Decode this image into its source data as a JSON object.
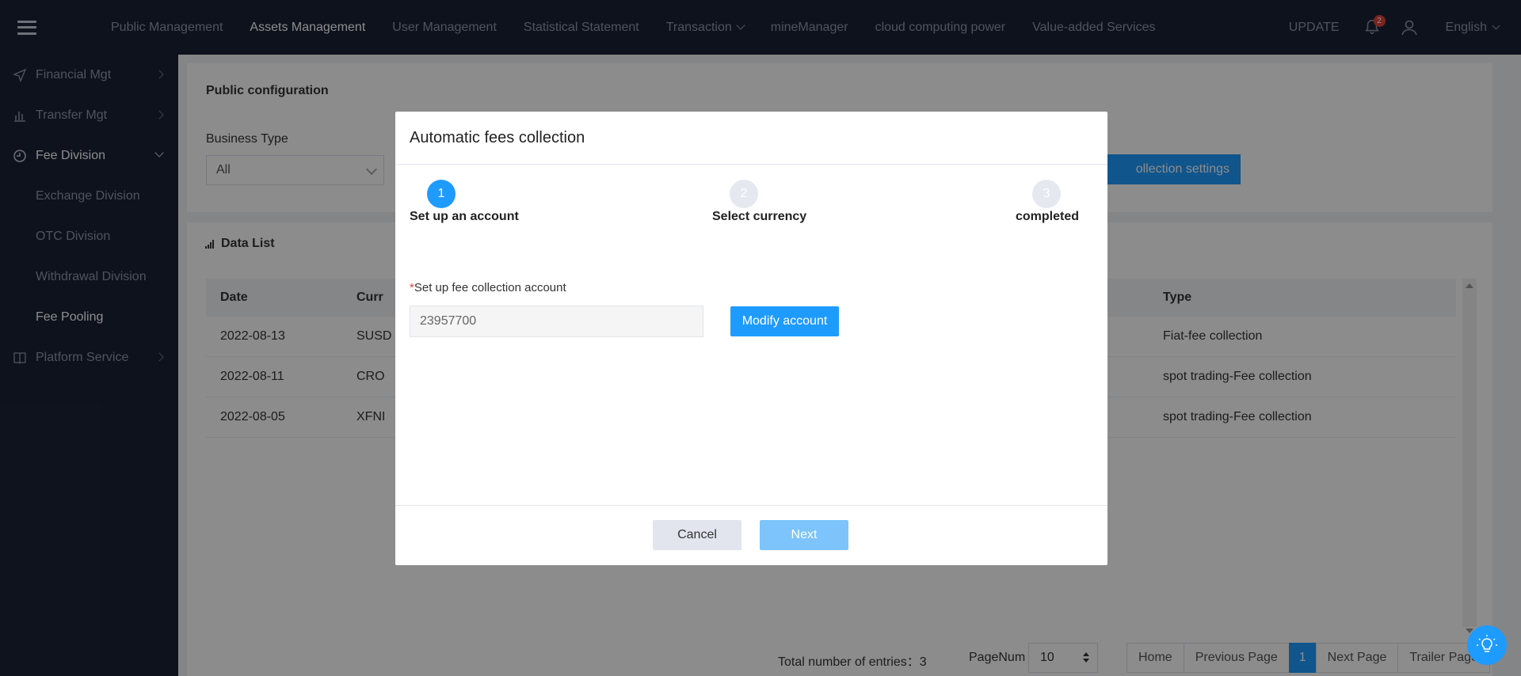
{
  "topbar": {
    "nav": [
      {
        "label": "Public Management",
        "active": false
      },
      {
        "label": "Assets Management",
        "active": true
      },
      {
        "label": "User Management",
        "active": false
      },
      {
        "label": "Statistical Statement",
        "active": false
      },
      {
        "label": "Transaction",
        "active": false
      },
      {
        "label": "mineManager",
        "active": false
      },
      {
        "label": "cloud computing power",
        "active": false
      },
      {
        "label": "Value-added Services",
        "active": false
      }
    ],
    "update_label": "UPDATE",
    "notification_count": "2",
    "language": "English"
  },
  "sidebar": {
    "items": [
      {
        "label": "Financial Mgt",
        "icon": "send-icon"
      },
      {
        "label": "Transfer Mgt",
        "icon": "bar-chart-icon"
      },
      {
        "label": "Fee Division",
        "icon": "clock-icon"
      },
      {
        "label": "Platform Service",
        "icon": "book-icon"
      }
    ],
    "sub_items": [
      {
        "label": "Exchange Division"
      },
      {
        "label": "OTC Division"
      },
      {
        "label": "Withdrawal Division"
      },
      {
        "label": "Fee Pooling"
      }
    ]
  },
  "config_card": {
    "title": "Public configuration",
    "business_type_label": "Business Type",
    "business_type_value": "All",
    "settings_button": "ollection settings"
  },
  "data_list": {
    "title": "Data List",
    "columns": {
      "date": "Date",
      "currency": "Curr",
      "type": "Type"
    },
    "rows": [
      {
        "date": "2022-08-13",
        "currency": "SUSD",
        "type": "Fiat-fee collection"
      },
      {
        "date": "2022-08-11",
        "currency": "CRO",
        "type": "spot trading-Fee collection"
      },
      {
        "date": "2022-08-05",
        "currency": "XFNI",
        "type": "spot trading-Fee collection"
      }
    ]
  },
  "pager": {
    "total_label": "Total number of entries：",
    "total": "3",
    "pagenum_label": "PageNum",
    "pagenum_value": "10",
    "home": "Home",
    "previous": "Previous Page",
    "current": "1",
    "next": "Next Page",
    "trailer": "Trailer Page"
  },
  "modal": {
    "title": "Automatic fees collection",
    "steps": [
      {
        "number": "1",
        "label": "Set up an account",
        "active": true
      },
      {
        "number": "2",
        "label": "Select currency",
        "active": false
      },
      {
        "number": "3",
        "label": "completed",
        "active": false
      }
    ],
    "field_required_mark": "*",
    "field_label": "Set up fee collection account",
    "field_value": "23957700",
    "modify_button": "Modify account",
    "cancel_button": "Cancel",
    "next_button": "Next"
  },
  "colors": {
    "primary": "#1e9bff",
    "nav_bg": "#1a2236",
    "badge": "#e0433a"
  }
}
